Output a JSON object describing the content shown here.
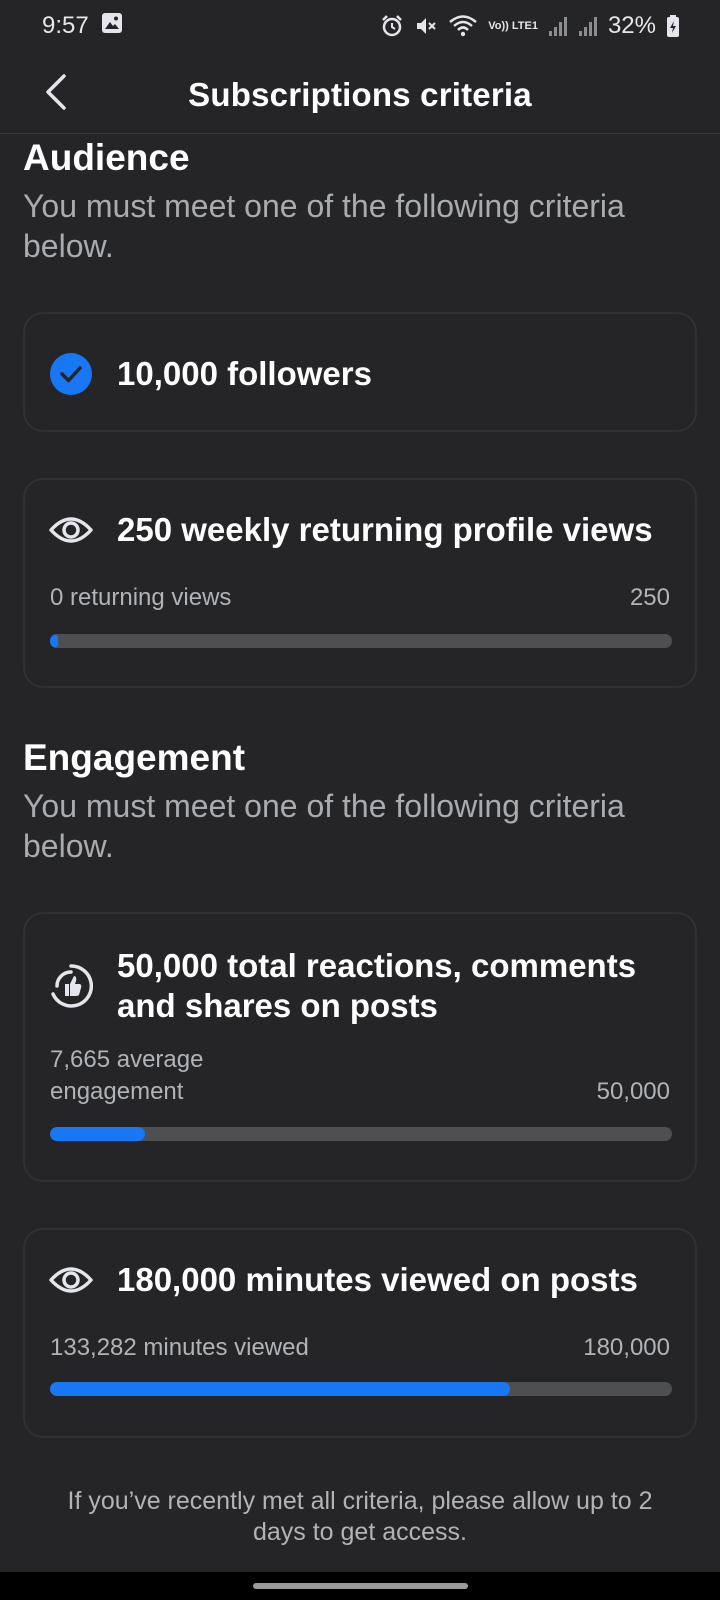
{
  "status_bar": {
    "time": "9:57",
    "icons": [
      "gallery-icon",
      "alarm-icon",
      "mute-icon",
      "wifi-icon",
      "volte-icon",
      "signal-icon",
      "signal-icon",
      "battery-icon"
    ],
    "volte_label": "Vo)) LTE1",
    "battery": "32%"
  },
  "header": {
    "title": "Subscriptions criteria",
    "back_icon": "chevron-left-icon"
  },
  "audience": {
    "title": "Audience",
    "description": "You must meet one of the following criteria below.",
    "followers": {
      "icon": "check-circle-icon",
      "title": "10,000 followers",
      "met": true
    },
    "profile_views": {
      "icon": "eye-icon",
      "title": "250 weekly returning profile views",
      "current_label": "0 returning views",
      "target_label": "250",
      "progress": 0.0
    }
  },
  "engagement": {
    "title": "Engagement",
    "description": "You must meet one of the following criteria below.",
    "reactions": {
      "icon": "thumbs-up-circle-icon",
      "title": "50,000 total reactions, comments and shares on posts",
      "current_label": "7,665 average engagement",
      "target_label": "50,000",
      "progress": 0.153
    },
    "minutes": {
      "icon": "eye-icon",
      "title": "180,000 minutes viewed on posts",
      "current_label": "133,282 minutes viewed",
      "target_label": "180,000",
      "progress": 0.74
    }
  },
  "footer_note": "If you’ve recently met all criteria, please allow up to 2 days to get access.",
  "colors": {
    "background": "#252528",
    "accent": "#1877f2",
    "track": "#4e4f52"
  }
}
